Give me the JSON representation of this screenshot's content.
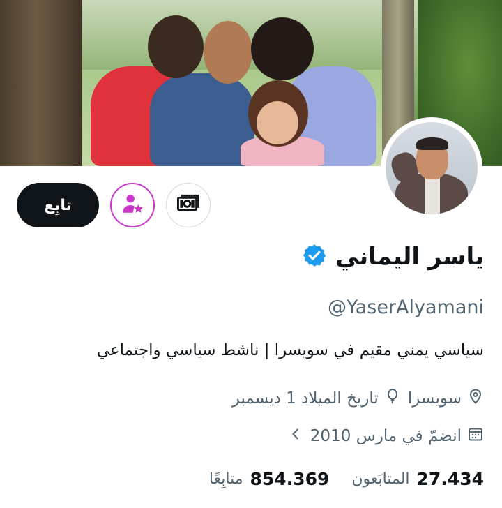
{
  "profile": {
    "name": "ياسر اليماني",
    "handle": "@YaserAlyamani",
    "bio": "سياسي يمني مقيم في سويسرا | ناشط سياسي واجتماعي",
    "location": "سويسرا",
    "birthday": "تاريخ الميلاد 1 ديسمبر",
    "joined": "انضمّ في مارس 2010",
    "verified": true
  },
  "stats": {
    "followers_count": "27.434",
    "followers_label": "المتابَعون",
    "following_count": "854.369",
    "following_label": "متابِعًا"
  },
  "actions": {
    "follow_label": "تابِع"
  },
  "icons": {
    "verified": "verified-badge-icon",
    "location": "location-pin-icon",
    "birthday": "balloon-icon",
    "joined": "calendar-icon",
    "subscribe": "person-star-icon",
    "tip": "money-icon",
    "more": "chevron-left-icon"
  },
  "colors": {
    "verified_blue": "#1d9bf0",
    "subscribe_magenta": "#c936c9",
    "follow_bg": "#0f1419",
    "secondary_text": "#536471"
  }
}
